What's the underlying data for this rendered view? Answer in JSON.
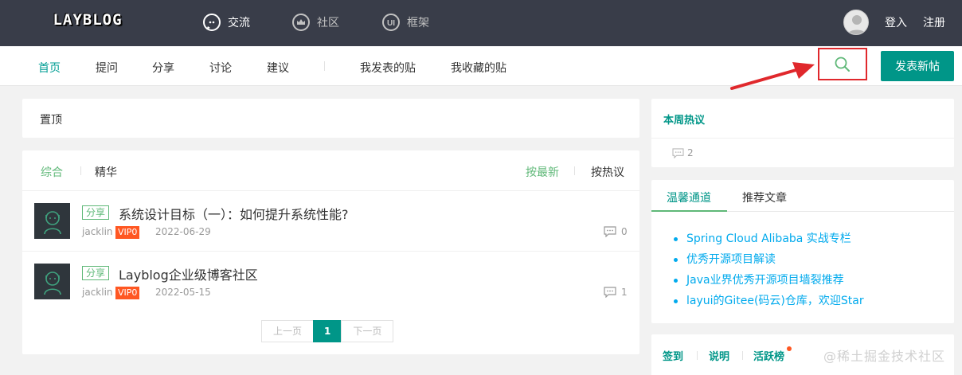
{
  "header": {
    "logo_text": "LAYBLOG",
    "nav": [
      {
        "label": "交流",
        "icon": "chat-icon"
      },
      {
        "label": "社区",
        "icon": "crown-icon"
      },
      {
        "label": "框架",
        "icon": "ui-icon"
      }
    ],
    "login": "登入",
    "register": "注册"
  },
  "subnav": {
    "items": [
      "首页",
      "提问",
      "分享",
      "讨论",
      "建议"
    ],
    "mine": [
      "我发表的贴",
      "我收藏的贴"
    ],
    "post_button": "发表新帖"
  },
  "pinned": {
    "title": "置顶"
  },
  "feed": {
    "tabs": [
      "综合",
      "精华"
    ],
    "sort": [
      "按最新",
      "按热议"
    ],
    "posts": [
      {
        "badge": "分享",
        "title": "系统设计目标（一）：如何提升系统性能?",
        "author": "jacklin",
        "vip": "VIP0",
        "date": "2022-06-29",
        "replies": "0"
      },
      {
        "badge": "分享",
        "title": "Layblog企业级博客社区",
        "author": "jacklin",
        "vip": "VIP0",
        "date": "2022-05-15",
        "replies": "1"
      }
    ],
    "pager": {
      "prev": "上一页",
      "current": "1",
      "next": "下一页"
    }
  },
  "hot": {
    "title": "本周热议",
    "count": "2"
  },
  "channels": {
    "tabs": [
      "温馨通道",
      "推荐文章"
    ],
    "links": [
      "Spring Cloud Alibaba 实战专栏",
      "优秀开源项目解读",
      "Java业界优秀开源项目墙裂推荐",
      "layui的Gitee(码云)仓库，欢迎Star"
    ]
  },
  "sign": {
    "tabs": [
      "签到",
      "说明",
      "活跃榜"
    ]
  },
  "watermark": "@稀土掘金技术社区",
  "colors": {
    "topbar": "#393d49",
    "accent": "#009688",
    "green": "#5fb878",
    "link": "#01aaed",
    "vip": "#ff5722",
    "highlight": "#e0282c"
  }
}
